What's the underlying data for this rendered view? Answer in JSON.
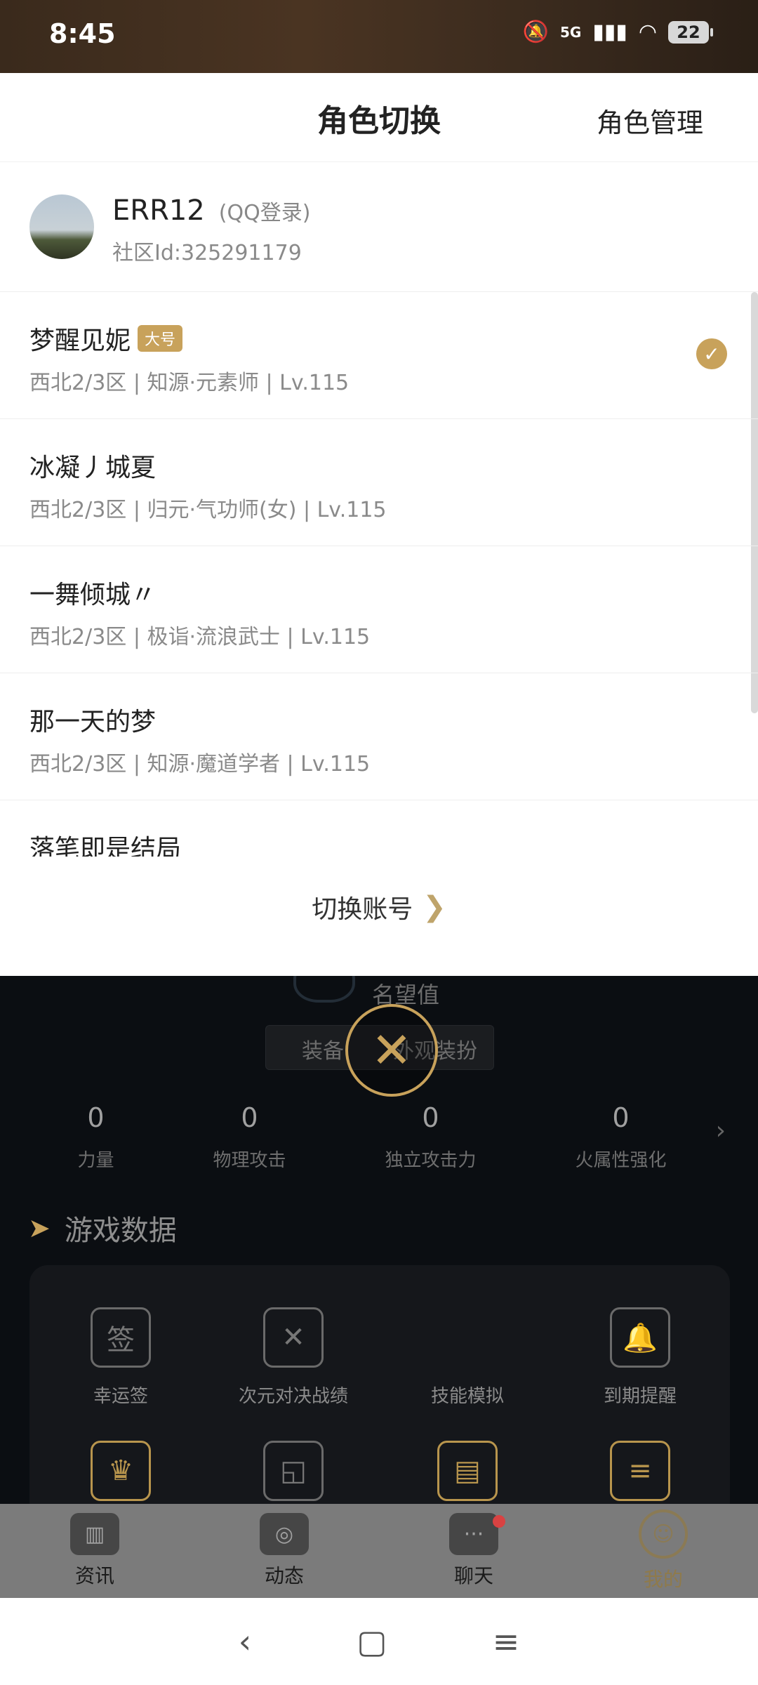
{
  "status": {
    "time": "8:45",
    "network": "5G",
    "battery": "22"
  },
  "sheet": {
    "title": "角色切换",
    "manage": "角色管理",
    "account": {
      "name": "ERR12",
      "login": "(QQ登录)",
      "community_id": "社区Id:325291179"
    },
    "roles": [
      {
        "name": "梦醒见妮",
        "badge": "大号",
        "info": "西北2/3区 | 知源·元素师 | Lv.115",
        "selected": true
      },
      {
        "name": "冰凝丿城夏",
        "badge": "",
        "info": "西北2/3区 | 归元·气功师(女) | Lv.115",
        "selected": false
      },
      {
        "name": "一舞倾城〃",
        "badge": "",
        "info": "西北2/3区 | 极诣·流浪武士 | Lv.115",
        "selected": false
      },
      {
        "name": "那一天的梦",
        "badge": "",
        "info": "西北2/3区 | 知源·魔道学者 | Lv.115",
        "selected": false
      },
      {
        "name": "落笔即是结局",
        "badge": "",
        "info": "",
        "selected": false
      }
    ],
    "switch_account": "切换账号"
  },
  "background": {
    "reputation": "名望值",
    "tabs": {
      "equip": "装备",
      "outfit": "外观装扮"
    },
    "stats": [
      {
        "value": "0",
        "label": "力量"
      },
      {
        "value": "0",
        "label": "物理攻击"
      },
      {
        "value": "0",
        "label": "独立攻击力"
      },
      {
        "value": "0",
        "label": "火属性强化"
      }
    ],
    "section_title": "游戏数据",
    "games": [
      {
        "label": "幸运签",
        "icon": "lucky-sign-icon"
      },
      {
        "label": "次元对决战绩",
        "icon": "dimension-duel-icon"
      },
      {
        "label": "技能模拟",
        "icon": "skill-sim-icon"
      },
      {
        "label": "到期提醒",
        "icon": "bell-icon"
      }
    ]
  },
  "nav": [
    {
      "label": "资讯",
      "icon": "news-icon"
    },
    {
      "label": "动态",
      "icon": "feed-icon"
    },
    {
      "label": "聊天",
      "icon": "chat-icon"
    },
    {
      "label": "我的",
      "icon": "profile-icon"
    }
  ],
  "colors": {
    "accent": "#c8a25b"
  }
}
